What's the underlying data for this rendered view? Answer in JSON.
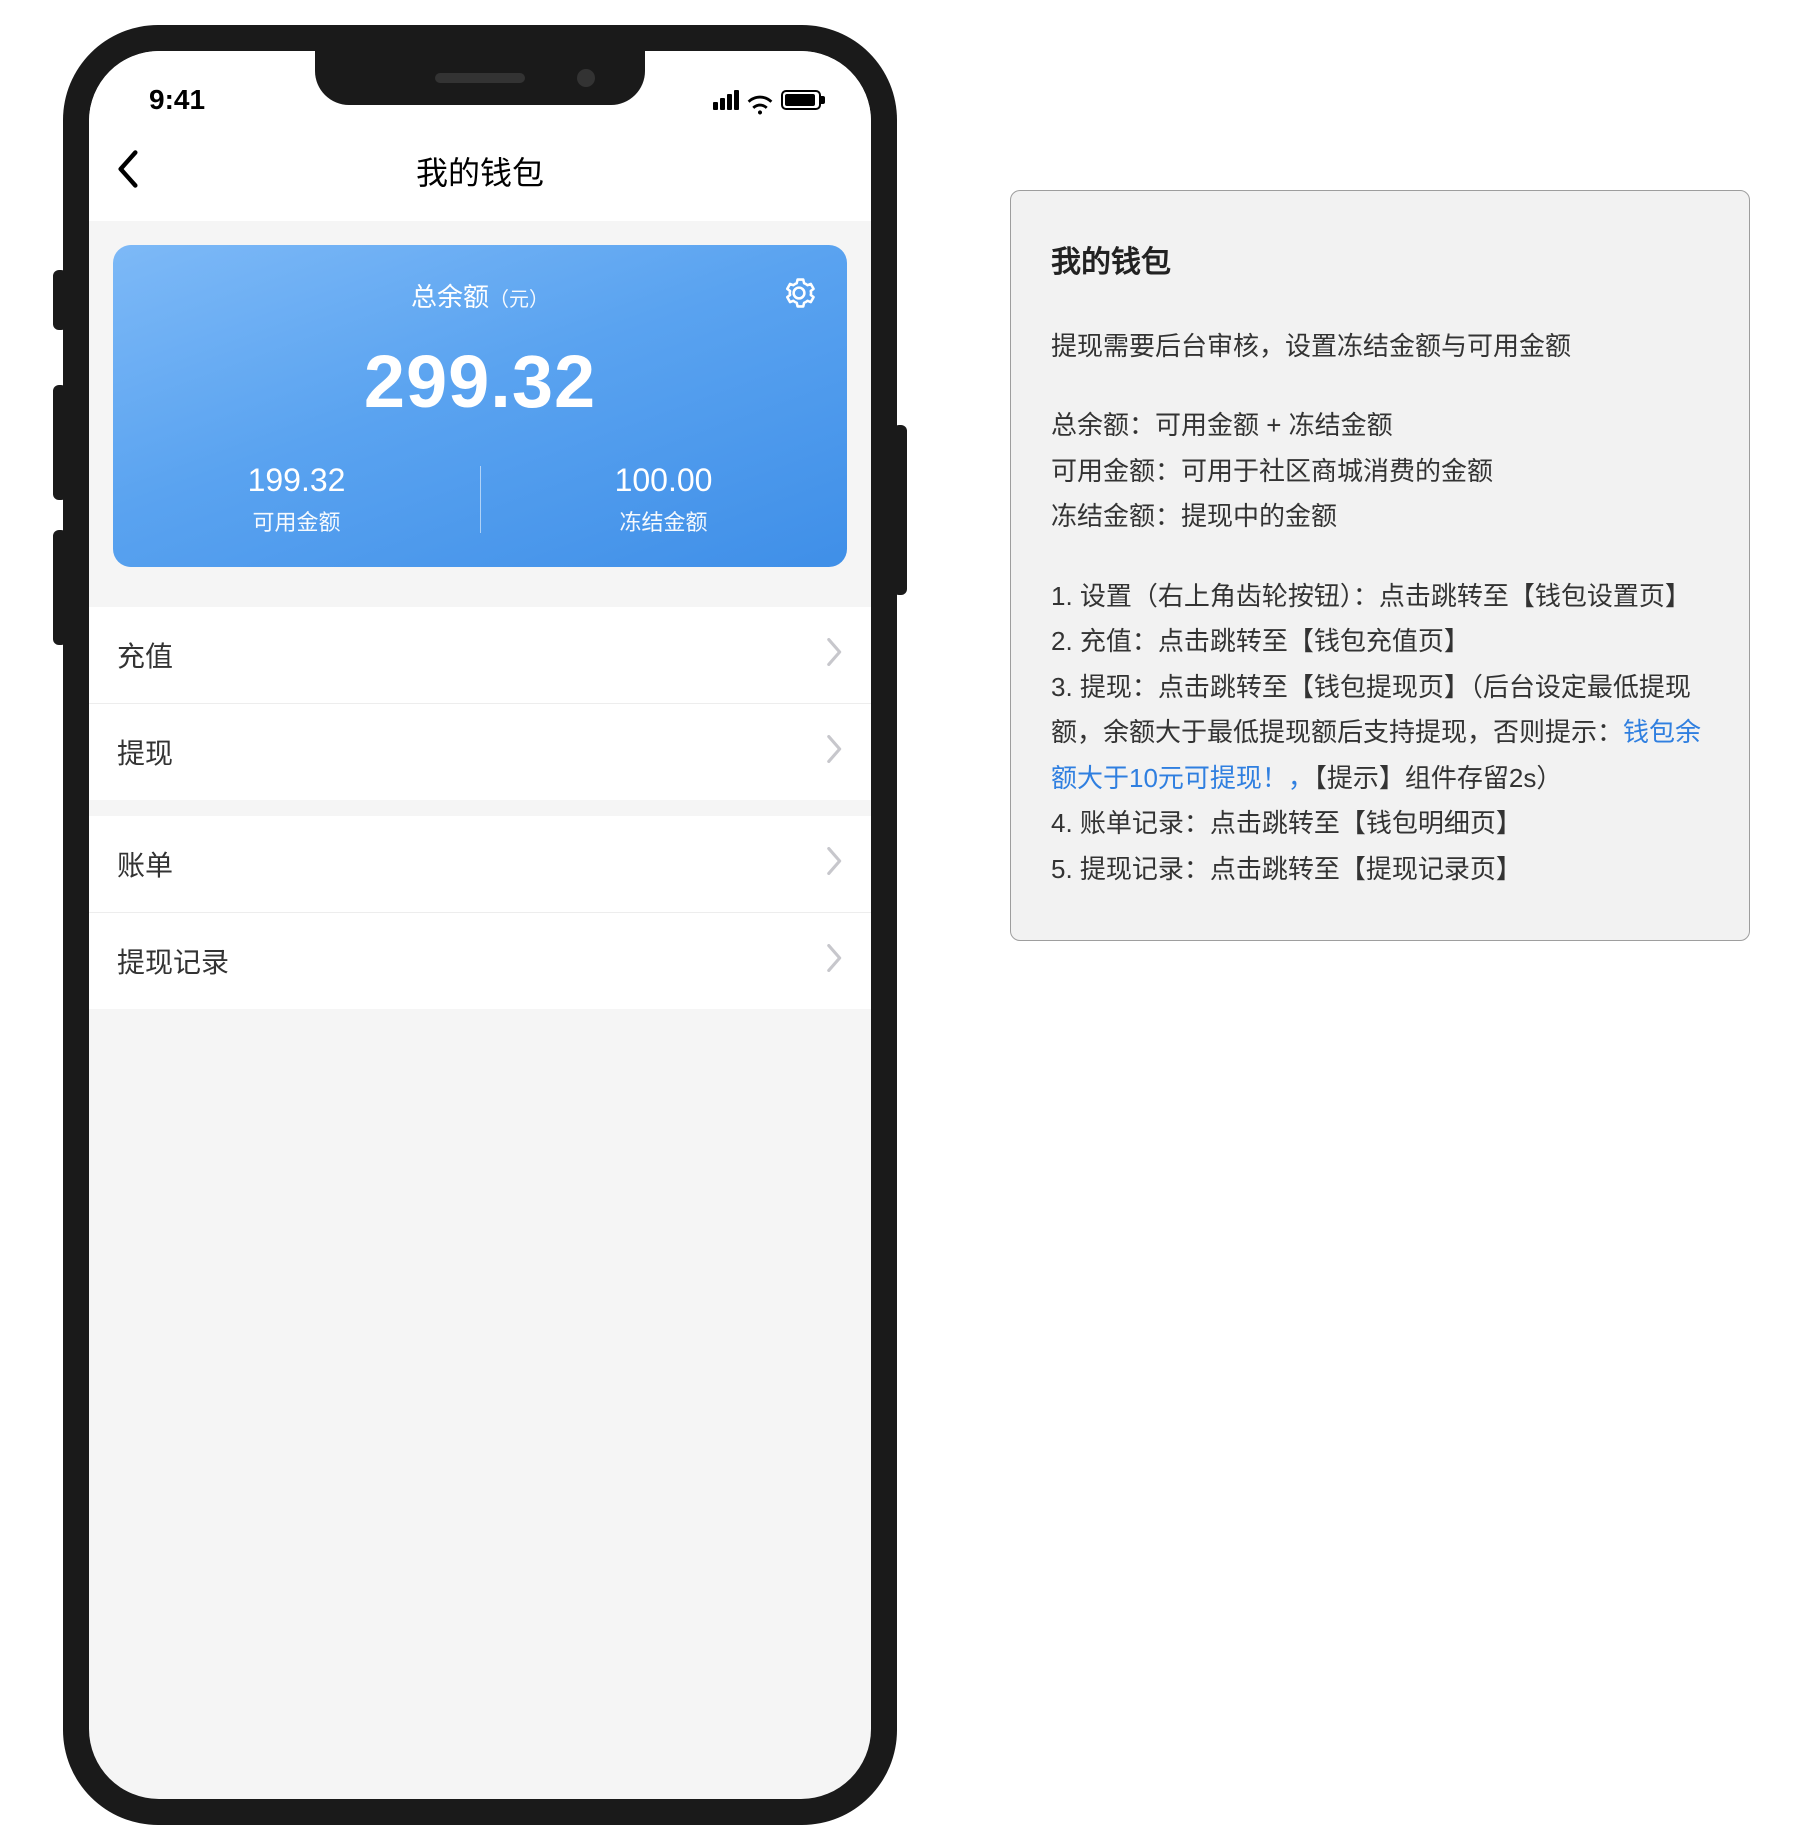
{
  "status_bar": {
    "time": "9:41"
  },
  "header": {
    "title": "我的钱包"
  },
  "balance_card": {
    "title": "总余额",
    "unit": "（元）",
    "total": "299.32",
    "available": {
      "value": "199.32",
      "label": "可用金额"
    },
    "frozen": {
      "value": "100.00",
      "label": "冻结金额"
    }
  },
  "menu": {
    "group1": [
      {
        "label": "充值"
      },
      {
        "label": "提现"
      }
    ],
    "group2": [
      {
        "label": "账单"
      },
      {
        "label": "提现记录"
      }
    ]
  },
  "spec": {
    "title": "我的钱包",
    "intro": "提现需要后台审核，设置冻结金额与可用金额",
    "defs": {
      "total": "总余额：可用金额 + 冻结金额",
      "available": "可用金额：可用于社区商城消费的金额",
      "frozen": "冻结金额：提现中的金额"
    },
    "items": {
      "i1": "1. 设置（右上角齿轮按钮）：点击跳转至【钱包设置页】",
      "i2": "2. 充值：点击跳转至【钱包充值页】",
      "i3a": "3. 提现：点击跳转至【钱包提现页】（后台设定最低提现额，余额大于最低提现额后支持提现，否则提示：",
      "i3_link": "钱包余额大于10元可提现！，",
      "i3b": "【提示】组件存留2s）",
      "i4": "4. 账单记录：点击跳转至【钱包明细页】",
      "i5": "5. 提现记录：点击跳转至【提现记录页】"
    }
  }
}
